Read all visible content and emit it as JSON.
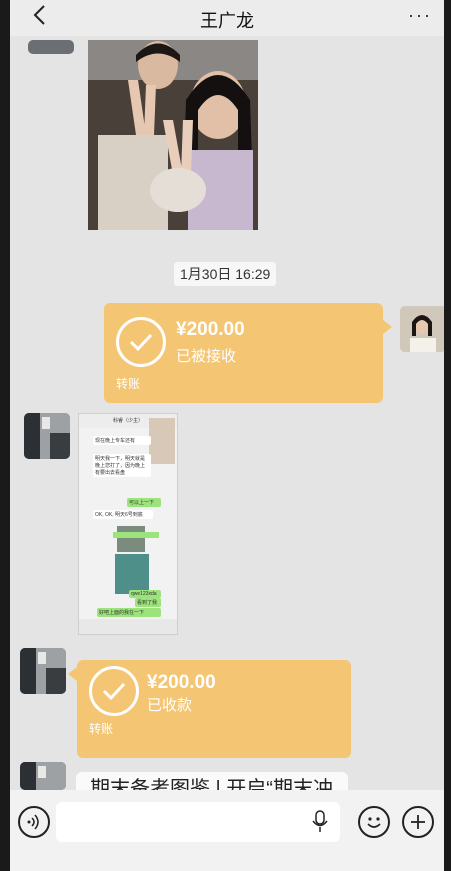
{
  "header": {
    "title": "王广龙",
    "back_icon": "chevron-left-icon",
    "more_label": "···"
  },
  "timestamp": "1月30日 16:29",
  "transfers": [
    {
      "amount": "¥200.00",
      "status": "已被接收",
      "label": "转账",
      "side": "outgoing"
    },
    {
      "amount": "¥200.00",
      "status": "已收款",
      "label": "转账",
      "side": "incoming"
    }
  ],
  "screenshot": {
    "header": "科睿（少主）",
    "messages": [
      "现在晚上专车还有",
      "明天我一下，明天就是晚上您打了，因为晚上有要出去看盘",
      "可以上一下",
      "OK, OK, 明天6号到底",
      "qwe123xda",
      "看到了我",
      "好吧上面的我在一下"
    ]
  },
  "partial_message": "期末备考图鉴 | 开启“期末冲",
  "input": {
    "voice_icon": "voice-icon",
    "mic_icon": "microphone-icon",
    "emoji_icon": "emoji-icon",
    "add_icon": "plus-icon"
  },
  "colors": {
    "transfer": "#f4c573",
    "background": "#e4e4e4"
  }
}
